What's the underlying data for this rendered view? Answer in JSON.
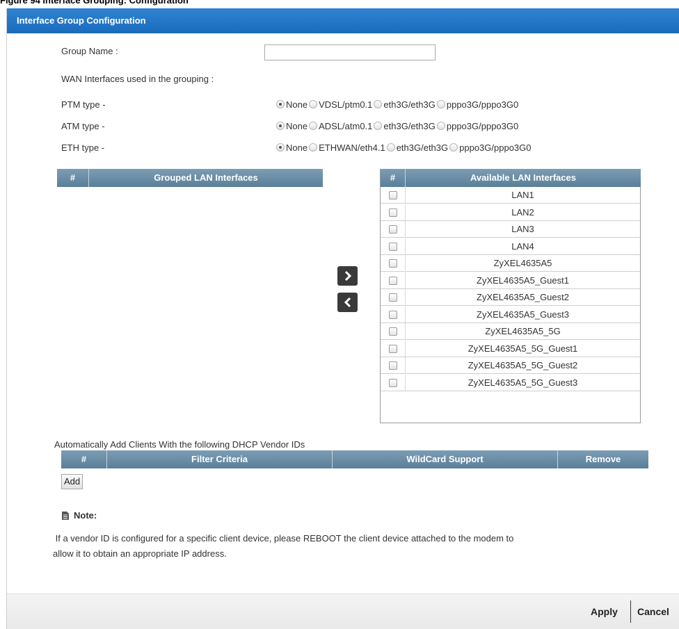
{
  "figure_caption": "Figure 94   Interface Grouping: Configuration",
  "header": {
    "title": "Interface Group Configuration"
  },
  "form": {
    "group_name_label": "Group Name :",
    "group_name_value": "",
    "wan_label": "WAN Interfaces used in the grouping :",
    "wan_rows": [
      {
        "label": "PTM type -",
        "options": [
          "None",
          "VDSL/ptm0.1",
          "eth3G/eth3G",
          "pppo3G/pppo3G0"
        ],
        "selected": 0
      },
      {
        "label": "ATM type -",
        "options": [
          "None",
          "ADSL/atm0.1",
          "eth3G/eth3G",
          "pppo3G/pppo3G0"
        ],
        "selected": 0
      },
      {
        "label": "ETH type -",
        "options": [
          "None",
          "ETHWAN/eth4.1",
          "eth3G/eth3G",
          "pppo3G/pppo3G0"
        ],
        "selected": 0
      }
    ]
  },
  "grouped_table": {
    "col_num": "#",
    "col_name": "Grouped LAN Interfaces",
    "rows": []
  },
  "available_table": {
    "col_num": "#",
    "col_name": "Available LAN Interfaces",
    "rows": [
      "LAN1",
      "LAN2",
      "LAN3",
      "LAN4",
      "ZyXEL4635A5",
      "ZyXEL4635A5_Guest1",
      "ZyXEL4635A5_Guest2",
      "ZyXEL4635A5_Guest3",
      "ZyXEL4635A5_5G",
      "ZyXEL4635A5_5G_Guest1",
      "ZyXEL4635A5_5G_Guest2",
      "ZyXEL4635A5_5G_Guest3"
    ]
  },
  "vendor": {
    "label": "Automatically Add Clients With the following DHCP Vendor IDs",
    "columns": [
      "#",
      "Filter Criteria",
      "WildCard Support",
      "Remove"
    ],
    "add_label": "Add"
  },
  "note": {
    "title": "Note:",
    "line1": " If a vendor ID is configured for a specific client device, please REBOOT the client device attached to the modem to",
    "line2": "allow it to obtain an appropriate IP address."
  },
  "footer": {
    "apply_label": "Apply",
    "cancel_label": "Cancel"
  },
  "colors": {
    "header_blue": "#1f74c6",
    "table_header": "#6a8da6"
  }
}
